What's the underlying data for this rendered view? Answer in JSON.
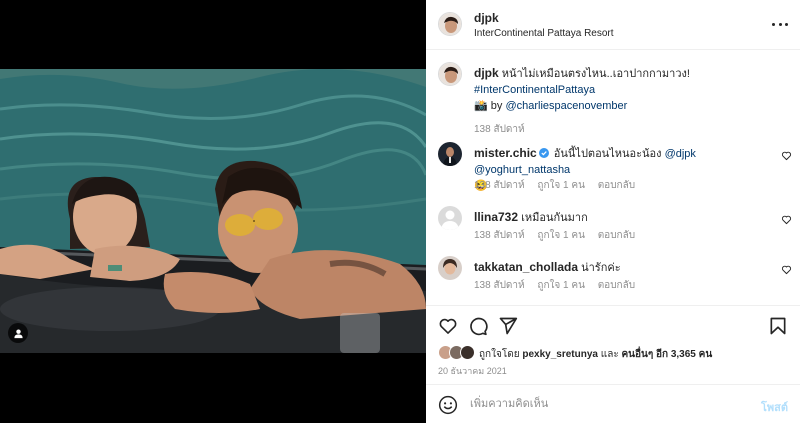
{
  "post": {
    "author": "djpk",
    "location": "InterContinental Pattaya Resort"
  },
  "caption": {
    "username": "djpk",
    "text": "หน้าไม่เหมือนตรงไหน..เอาปากกามาวง!",
    "hashtag": "#InterContinentalPattaya",
    "camera_emoji": "📸",
    "by_label": "by",
    "credit": "@charliespacenovember",
    "time": "138 สัปดาห์"
  },
  "comments": [
    {
      "username": "mister.chic",
      "verified": true,
      "text": "อันนี้ไปตอนไหนอะน้อง",
      "mentions": [
        "@djpk",
        "@yoghurt_nattasha"
      ],
      "emoji": "😆",
      "time": "138 สัปดาห์",
      "likes": "ถูกใจ 1 คน",
      "reply": "ตอบกลับ"
    },
    {
      "username": "llina732",
      "text": "เหมือนกันมาก",
      "time": "138 สัปดาห์",
      "likes": "ถูกใจ 1 คน",
      "reply": "ตอบกลับ"
    },
    {
      "username": "takkatan_chollada",
      "text": "น่ารักค่ะ",
      "time": "138 สัปดาห์",
      "likes": "ถูกใจ 1 คน",
      "reply": "ตอบกลับ"
    }
  ],
  "likes": {
    "prefix": "ถูกใจโดย",
    "user": "pexky_sretunya",
    "and": "และ",
    "others": "คนอื่นๆ อีก 3,365 คน"
  },
  "date": "20 ธันวาคม 2021",
  "add_comment": {
    "placeholder": "เพิ่มความคิดเห็น",
    "post_label": "โพสต์"
  },
  "icons": {
    "more": "more-dots-icon",
    "heart": "heart-icon",
    "comment": "comment-icon",
    "share": "share-icon",
    "save": "bookmark-icon",
    "emoji": "emoji-icon",
    "tagged": "person-tag-icon"
  },
  "colors": {
    "link": "#00376b",
    "meta": "#8e8e8e",
    "verified": "#3897f0",
    "post_button_disabled": "#b2dffc"
  }
}
